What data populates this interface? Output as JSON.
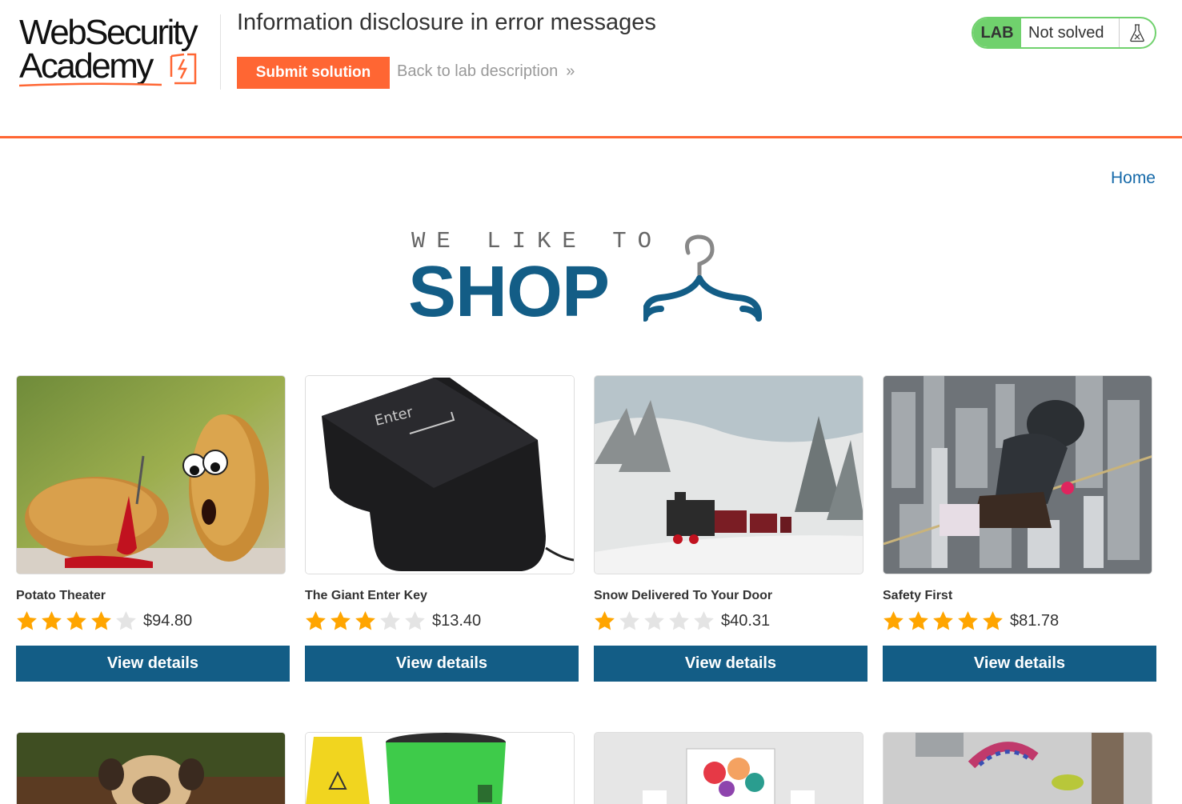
{
  "academy": {
    "logo_line1": "WebSecurity",
    "logo_line2": "Academy",
    "lab_title": "Information disclosure in error messages",
    "submit_label": "Submit solution",
    "back_label": "Back to lab description",
    "lab_badge": "LAB",
    "lab_status": "Not solved",
    "accent_color": "#ff6633",
    "status_color": "#70d16d"
  },
  "shop": {
    "home_label": "Home",
    "banner_top": "WE LIKE TO",
    "banner_main": "SHOP",
    "brand_color": "#135d86",
    "products": [
      {
        "name": "Potato Theater",
        "rating": 4,
        "price": "$94.80",
        "button": "View details"
      },
      {
        "name": "The Giant Enter Key",
        "rating": 3,
        "price": "$13.40",
        "button": "View details"
      },
      {
        "name": "Snow Delivered To Your Door",
        "rating": 1,
        "price": "$40.31",
        "button": "View details"
      },
      {
        "name": "Safety First",
        "rating": 5,
        "price": "$81.78",
        "button": "View details"
      }
    ]
  }
}
